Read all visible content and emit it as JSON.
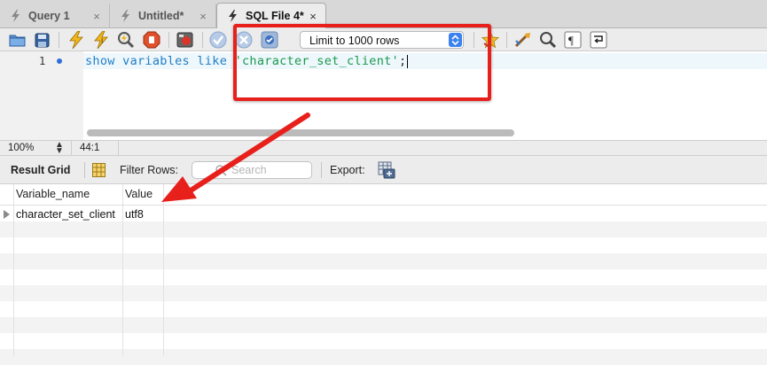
{
  "tabs": [
    {
      "label": "Query 1",
      "active": false
    },
    {
      "label": "Untitled*",
      "active": false
    },
    {
      "label": "SQL File 4*",
      "active": true
    }
  ],
  "tab_close_glyph": "×",
  "toolbar": {
    "icons": [
      "open-file-icon",
      "save-icon",
      "execute-icon",
      "execute-current-icon",
      "explain-icon",
      "stop-icon",
      "toggle-error-icon",
      "commit-icon",
      "rollback-icon",
      "autocommit-icon",
      "add-snippet-icon",
      "beautify-icon",
      "find-icon",
      "invisible-chars-icon",
      "wrap-lines-icon"
    ],
    "limit_select": {
      "value": "Limit to 1000 rows"
    }
  },
  "editor": {
    "line_number": "1",
    "code": {
      "keywords": "show variables like ",
      "string": "'character_set_client'",
      "terminator": ";"
    }
  },
  "status": {
    "zoom": "100%",
    "cursor_position": "44:1"
  },
  "result_toolbar": {
    "result_grid_label": "Result Grid",
    "filter_label": "Filter Rows:",
    "search_placeholder": "Search",
    "export_label": "Export:"
  },
  "grid": {
    "columns": [
      "Variable_name",
      "Value"
    ],
    "rows": [
      [
        "character_set_client",
        "utf8"
      ]
    ]
  },
  "colors": {
    "annotation_red": "#e8201c",
    "keyword_blue": "#1e7ec8",
    "string_green": "#1a9a50",
    "accent_blue": "#3b82f0"
  }
}
